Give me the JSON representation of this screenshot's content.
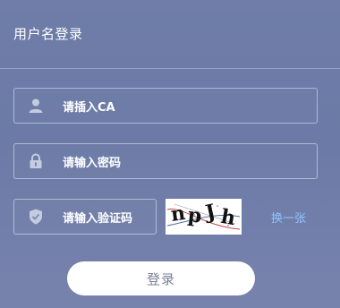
{
  "header": {
    "title": "用户名登录"
  },
  "form": {
    "ca_field": {
      "label": "请插入CA",
      "icon": "user-icon"
    },
    "password_field": {
      "label": "请输入密码",
      "icon": "lock-icon"
    },
    "captcha_field": {
      "label": "请输入验证码",
      "icon": "shield-icon"
    },
    "captcha_chars": [
      "n",
      "p",
      "J",
      "h"
    ],
    "refresh_label": "换一张",
    "login_label": "登录"
  },
  "colors": {
    "background": "#6f7da8",
    "refresh_link": "#8fc4ff",
    "button_bg": "#ffffff",
    "button_text": "#7a8099"
  }
}
